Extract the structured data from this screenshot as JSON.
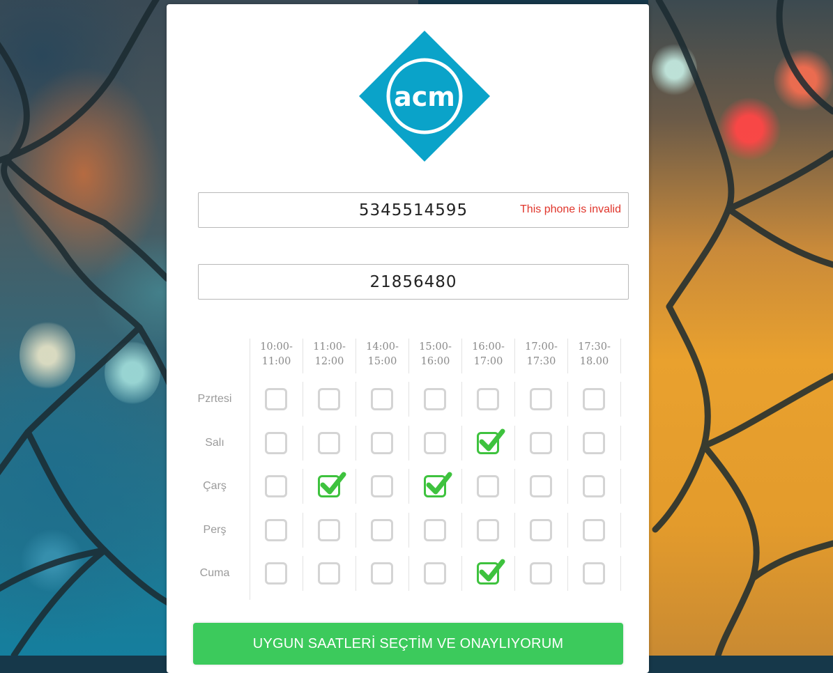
{
  "form": {
    "phone_value": "5345514595",
    "phone_error": "This phone is invalid",
    "id_value": "21856480"
  },
  "logo": {
    "text": "acm",
    "color": "#0aa3c9"
  },
  "schedule": {
    "times": [
      {
        "line1": "10:00-",
        "line2": "11:00"
      },
      {
        "line1": "11:00-",
        "line2": "12:00"
      },
      {
        "line1": "14:00-",
        "line2": "15:00"
      },
      {
        "line1": "15:00-",
        "line2": "16:00"
      },
      {
        "line1": "16:00-",
        "line2": "17:00"
      },
      {
        "line1": "17:00-",
        "line2": "17:30"
      },
      {
        "line1": "17:30-",
        "line2": "18.00"
      }
    ],
    "days": [
      "Pzrtesi",
      "Salı",
      "Çarş",
      "Perş",
      "Cuma"
    ],
    "checked": [
      [
        false,
        false,
        false,
        false,
        false,
        false,
        false
      ],
      [
        false,
        false,
        false,
        false,
        true,
        false,
        false
      ],
      [
        false,
        true,
        false,
        true,
        false,
        false,
        false
      ],
      [
        false,
        false,
        false,
        false,
        false,
        false,
        false
      ],
      [
        false,
        false,
        false,
        false,
        true,
        false,
        false
      ]
    ]
  },
  "submit_label": "UYGUN SAATLERİ SEÇTİM VE ONAYLIYORUM",
  "colors": {
    "accent_green": "#3cca5c",
    "check_green": "#3ec23e",
    "error_red": "#e0352b"
  }
}
